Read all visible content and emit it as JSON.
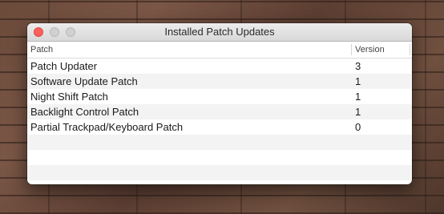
{
  "window": {
    "title": "Installed Patch Updates"
  },
  "table": {
    "columns": [
      "Patch",
      "Version"
    ],
    "rows": [
      {
        "name": "Patch Updater",
        "version": "3"
      },
      {
        "name": "Software Update Patch",
        "version": "1"
      },
      {
        "name": "Night Shift Patch",
        "version": "1"
      },
      {
        "name": "Backlight Control Patch",
        "version": "1"
      },
      {
        "name": "Partial Trackpad/Keyboard Patch",
        "version": "0"
      }
    ],
    "empty_row_count": 3
  },
  "colors": {
    "close_button": "#fc605c",
    "stripe": "#f3f3f3"
  }
}
